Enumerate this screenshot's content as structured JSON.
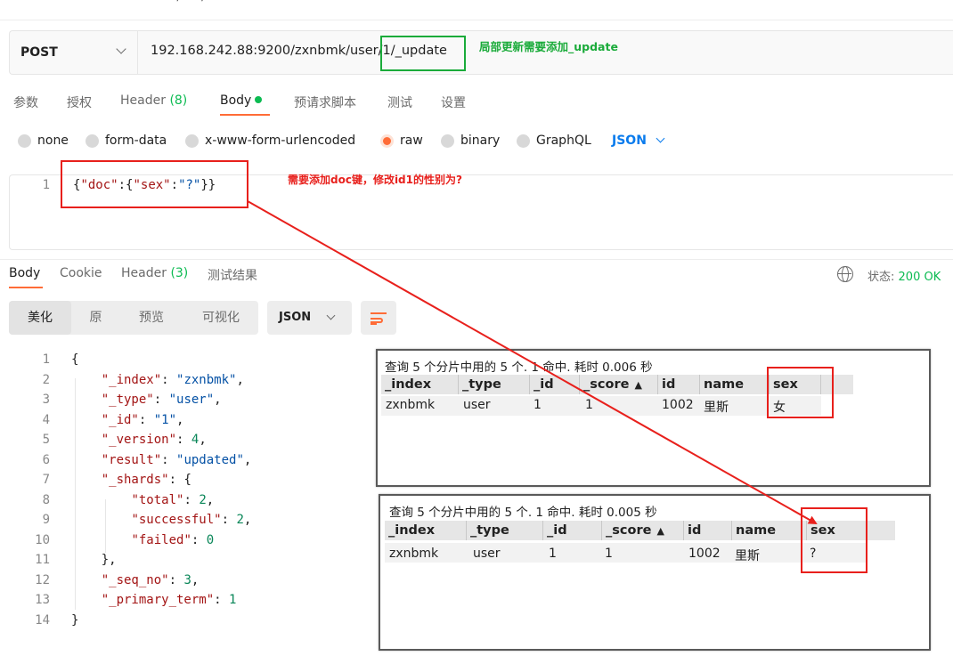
{
  "top_cut_text": "… / … / …",
  "request": {
    "method": "POST",
    "url": "192.168.242.88:9200/zxnbmk/user/1/_update"
  },
  "request_tabs": [
    {
      "label": "参数"
    },
    {
      "label": "授权"
    },
    {
      "label": "Header",
      "count": "(8)"
    },
    {
      "label": "Body"
    },
    {
      "label": "预请求脚本"
    },
    {
      "label": "测试"
    },
    {
      "label": "设置"
    }
  ],
  "body_types": [
    "none",
    "form-data",
    "x-www-form-urlencoded",
    "raw",
    "binary",
    "GraphQL"
  ],
  "body_format": "JSON",
  "request_body": {
    "line_no": "1",
    "open": "{",
    "key_doc": "\"doc\"",
    "colon1": ":",
    "open2": "{",
    "key_sex": "\"sex\"",
    "colon2": ":",
    "val_sex": "\"?\"",
    "close": "}}"
  },
  "response_tabs": [
    {
      "label": "Body"
    },
    {
      "label": "Cookie"
    },
    {
      "label": "Header",
      "count": "(3)"
    },
    {
      "label": "测试结果"
    }
  ],
  "status": {
    "label": "状态:",
    "value": "200 OK"
  },
  "view_tabs": [
    "美化",
    "原",
    "预览",
    "可视化"
  ],
  "response_format": "JSON",
  "response_lines": [
    {
      "n": "1"
    },
    {
      "n": "2"
    },
    {
      "n": "3"
    },
    {
      "n": "4"
    },
    {
      "n": "5"
    },
    {
      "n": "6"
    },
    {
      "n": "7"
    },
    {
      "n": "8"
    },
    {
      "n": "9"
    },
    {
      "n": "10"
    },
    {
      "n": "11"
    },
    {
      "n": "12"
    },
    {
      "n": "13"
    },
    {
      "n": "14"
    }
  ],
  "response_json": {
    "open": "{",
    "index_key": "\"_index\"",
    "index_val": "\"zxnbmk\"",
    "type_key": "\"_type\"",
    "type_val": "\"user\"",
    "id_key": "\"_id\"",
    "id_val": "\"1\"",
    "version_key": "\"_version\"",
    "version_val": "4",
    "result_key": "\"result\"",
    "result_val": "\"updated\"",
    "shards_key": "\"_shards\"",
    "shards_open": "{",
    "total_key": "\"total\"",
    "total_val": "2",
    "successful_key": "\"successful\"",
    "successful_val": "2",
    "failed_key": "\"failed\"",
    "failed_val": "0",
    "shards_close": "},",
    "seq_key": "\"_seq_no\"",
    "seq_val": "3",
    "primary_key": "\"_primary_term\"",
    "primary_val": "1",
    "close": "}"
  },
  "query_before": {
    "title": "查询 5 个分片中用的 5 个. 1 命中. 耗时 0.006 秒",
    "columns": [
      "_index",
      "_type",
      "_id",
      "_score",
      "id",
      "name",
      "sex"
    ],
    "sort_indicator": "▲",
    "row": [
      "zxnbmk",
      "user",
      "1",
      "1",
      "1002",
      "里斯",
      "女"
    ]
  },
  "query_after": {
    "title": "查询 5 个分片中用的 5 个. 1 命中. 耗时 0.005 秒",
    "columns": [
      "_index",
      "_type",
      "_id",
      "_score",
      "id",
      "name",
      "sex"
    ],
    "sort_indicator": "▲",
    "row": [
      "zxnbmk",
      "user",
      "1",
      "1",
      "1002",
      "里斯",
      "?"
    ]
  },
  "annotations": {
    "update_note": "局部更新需要添加_update",
    "doc_note": "需要添加doc键，修改id1的性别为?"
  },
  "colors": {
    "accent": "#ff6c37",
    "green": "#0cbb52",
    "link_blue": "#097bed",
    "annotation_red": "#e8201c",
    "annotation_green": "#1aab3a"
  }
}
